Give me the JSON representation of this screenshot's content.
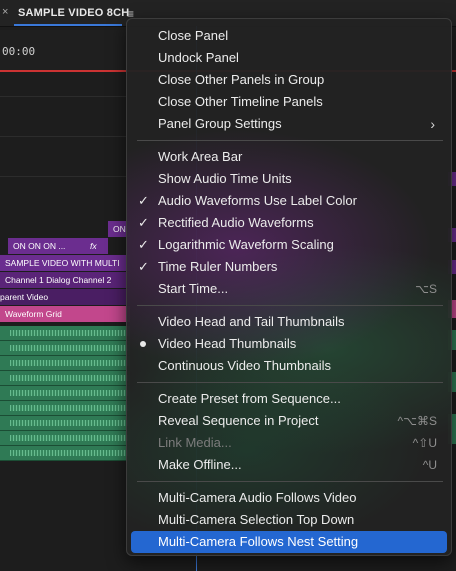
{
  "tab": {
    "close": "×",
    "title": "SAMPLE VIDEO 8CH",
    "menu": "≡"
  },
  "timeline": {
    "timecode": "00:00",
    "clips": {
      "on_right": "ON",
      "on_on": "ON ON ON ...",
      "fx": "fx",
      "sample_video": "SAMPLE VIDEO WITH MULTI",
      "channel": "Channel 1 Dialog Channel 2",
      "parent_video": "parent Video",
      "waveform_grid": "Waveform Grid"
    }
  },
  "menu": {
    "groups": [
      [
        {
          "label": "Close Panel"
        },
        {
          "label": "Undock Panel"
        },
        {
          "label": "Close Other Panels in Group"
        },
        {
          "label": "Close Other Timeline Panels"
        },
        {
          "label": "Panel Group Settings",
          "submenu": "›"
        }
      ],
      [
        {
          "label": "Work Area Bar"
        },
        {
          "label": "Show Audio Time Units"
        },
        {
          "label": "Audio Waveforms Use Label Color",
          "check": "✓"
        },
        {
          "label": "Rectified Audio Waveforms",
          "check": "✓"
        },
        {
          "label": "Logarithmic Waveform Scaling",
          "check": "✓"
        },
        {
          "label": "Time Ruler Numbers",
          "check": "✓"
        },
        {
          "label": "Start Time...",
          "shortcut": "⌥S"
        }
      ],
      [
        {
          "label": "Video Head and Tail Thumbnails"
        },
        {
          "label": "Video Head Thumbnails",
          "radio": true
        },
        {
          "label": "Continuous Video Thumbnails"
        }
      ],
      [
        {
          "label": "Create Preset from Sequence..."
        },
        {
          "label": "Reveal Sequence in Project",
          "shortcut": "^⌥⌘S"
        },
        {
          "label": "Link Media...",
          "shortcut": "^⇧U",
          "disabled": true
        },
        {
          "label": "Make Offline...",
          "shortcut": "^U"
        }
      ],
      [
        {
          "label": "Multi-Camera Audio Follows Video"
        },
        {
          "label": "Multi-Camera Selection Top Down"
        },
        {
          "label": "Multi-Camera Follows Nest Setting",
          "highlighted": true
        }
      ]
    ]
  },
  "colors": {
    "accent": "#2467d1",
    "clip_purple": "#6b2d8f",
    "clip_pink": "#c2478c",
    "audio_green": "#2f7a55",
    "playhead": "#3a78d8"
  }
}
